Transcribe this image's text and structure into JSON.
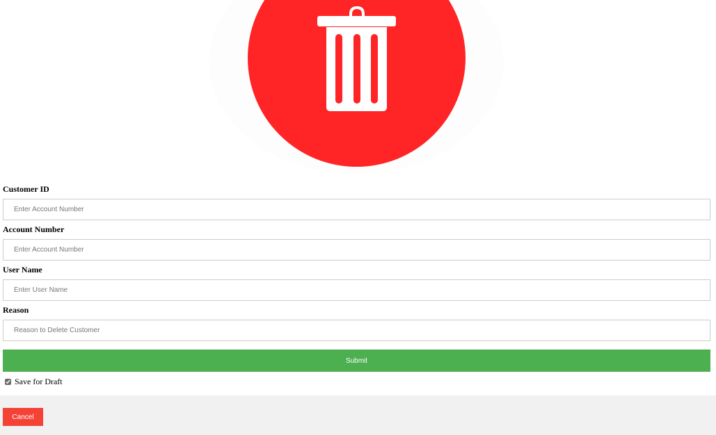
{
  "header": {
    "icon": "trash-icon",
    "icon_color": "#ffffff",
    "circle_color": "#ff2426"
  },
  "form": {
    "fields": [
      {
        "label": "Customer ID",
        "placeholder": "Enter Account Number",
        "value": ""
      },
      {
        "label": "Account Number",
        "placeholder": "Enter Account Number",
        "value": ""
      },
      {
        "label": "User Name",
        "placeholder": "Enter User Name",
        "value": ""
      },
      {
        "label": "Reason",
        "placeholder": "Reason to Delete Customer",
        "value": ""
      }
    ],
    "submit_label": "Submit",
    "submit_color": "#4caf50",
    "draft_label": "Save for Draft",
    "draft_checked": true
  },
  "footer": {
    "cancel_label": "Cancel",
    "cancel_color": "#f44336"
  }
}
